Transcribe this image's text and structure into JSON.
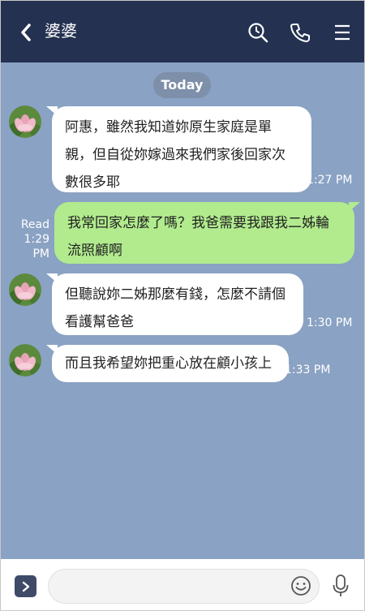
{
  "header": {
    "title": "婆婆",
    "back_icon": "chevron-left-icon",
    "search_icon": "search-icon",
    "call_icon": "phone-icon",
    "menu_icon": "menu-icon"
  },
  "chat": {
    "date_label": "Today",
    "messages": [
      {
        "side": "in",
        "text": "阿惠，雖然我知道妳原生家庭是單親，但自從妳嫁過來我們家後回家次數很多耶",
        "time": "1:27 PM"
      },
      {
        "side": "out",
        "text": "我常回家怎麼了嗎？我爸需要我跟我二姊輪流照顧啊",
        "read": "Read",
        "time": "1:29 PM"
      },
      {
        "side": "in",
        "text": "但聽說妳二姊那麼有錢，怎麼不請個看護幫爸爸",
        "time": "1:30 PM"
      },
      {
        "side": "in",
        "text": "而且我希望妳把重心放在顧小孩上",
        "time": "1:33 PM"
      }
    ]
  },
  "footer": {
    "input_placeholder": "",
    "expand_icon": "chevron-right-icon",
    "emoji_icon": "smiley-icon",
    "mic_icon": "microphone-icon"
  },
  "colors": {
    "header_bg": "#243150",
    "chat_bg": "#8aa2c3",
    "outgoing_bubble": "#b1eb8e",
    "incoming_bubble": "#ffffff"
  }
}
